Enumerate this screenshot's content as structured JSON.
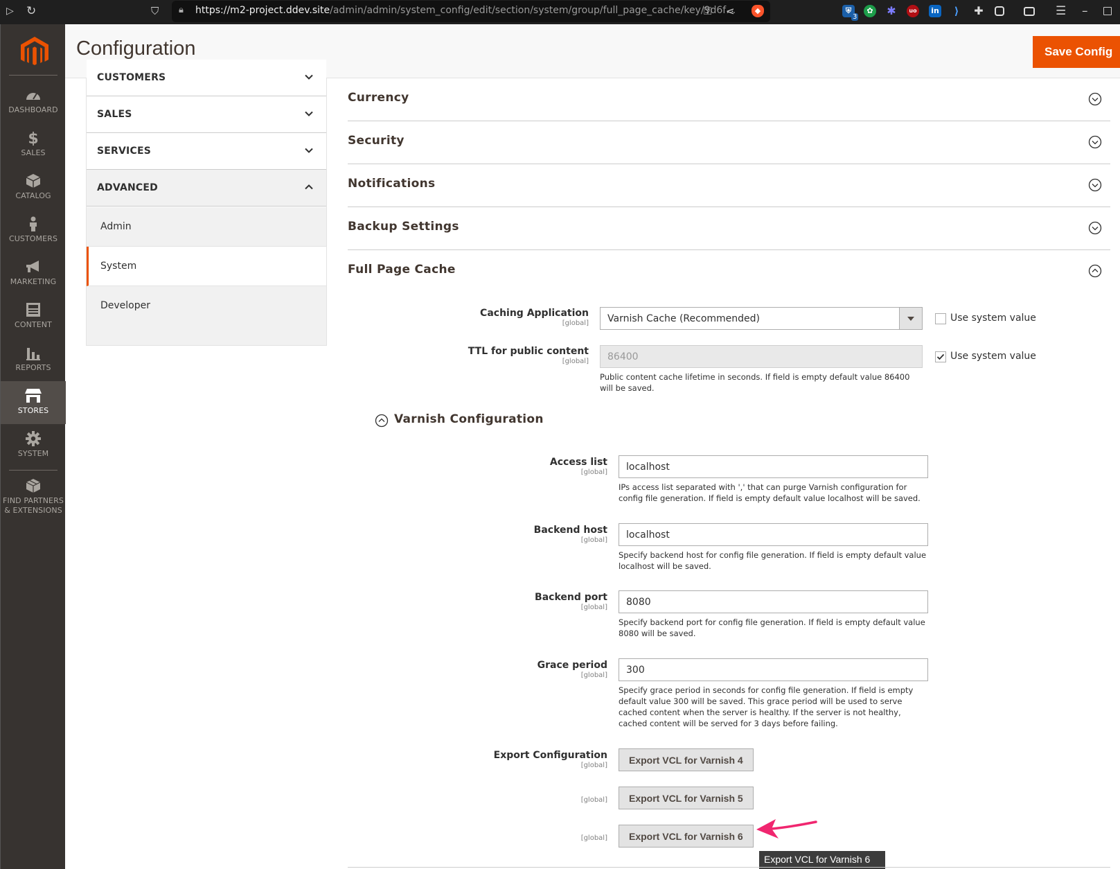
{
  "browser": {
    "url_host": "https://m2-project.ddev.site",
    "url_path": "/admin/admin/system_config/edit/section/system/group/full_page_cache/key/9d6f…",
    "ext_badge": "3"
  },
  "admin_nav": {
    "items": [
      {
        "label": "DASHBOARD",
        "icon": "dashboard-icon"
      },
      {
        "label": "SALES",
        "icon": "dollar-icon"
      },
      {
        "label": "CATALOG",
        "icon": "box-icon"
      },
      {
        "label": "CUSTOMERS",
        "icon": "person-icon"
      },
      {
        "label": "MARKETING",
        "icon": "megaphone-icon"
      },
      {
        "label": "CONTENT",
        "icon": "content-icon"
      },
      {
        "label": "REPORTS",
        "icon": "bar-chart-icon"
      },
      {
        "label": "STORES",
        "icon": "store-icon",
        "active": true
      },
      {
        "label": "SYSTEM",
        "icon": "gear-icon"
      },
      {
        "label_line1": "FIND PARTNERS",
        "label_line2": "& EXTENSIONS",
        "icon": "cubes-icon"
      }
    ]
  },
  "header": {
    "title": "Configuration",
    "save_label": "Save Config"
  },
  "config_tabs": {
    "groups": [
      {
        "label": "CUSTOMERS",
        "expanded": false
      },
      {
        "label": "SALES",
        "expanded": false
      },
      {
        "label": "SERVICES",
        "expanded": false
      },
      {
        "label": "ADVANCED",
        "expanded": true
      }
    ],
    "advanced_items": [
      "Admin",
      "System",
      "Developer"
    ],
    "active_item": "System"
  },
  "sections": {
    "currency": "Currency",
    "security": "Security",
    "notifications": "Notifications",
    "backup": "Backup Settings",
    "fpc": "Full Page Cache"
  },
  "fpc": {
    "caching_app": {
      "label": "Caching Application",
      "scope": "[global]",
      "value": "Varnish Cache (Recommended)",
      "use_system_label": "Use system value",
      "use_system_checked": false
    },
    "ttl": {
      "label": "TTL for public content",
      "scope": "[global]",
      "value": "86400",
      "note": "Public content cache lifetime in seconds. If field is empty default value 86400 will be saved.",
      "use_system_label": "Use system value",
      "use_system_checked": true
    },
    "varnish": {
      "title": "Varnish Configuration",
      "access_list": {
        "label": "Access list",
        "scope": "[global]",
        "value": "localhost",
        "note": "IPs access list separated with ',' that can purge Varnish configuration for config file generation. If field is empty default value localhost will be saved."
      },
      "backend_host": {
        "label": "Backend host",
        "scope": "[global]",
        "value": "localhost",
        "note": "Specify backend host for config file generation. If field is empty default value localhost will be saved."
      },
      "backend_port": {
        "label": "Backend port",
        "scope": "[global]",
        "value": "8080",
        "note": "Specify backend port for config file generation. If field is empty default value 8080 will be saved."
      },
      "grace_period": {
        "label": "Grace period",
        "scope": "[global]",
        "value": "300",
        "note": "Specify grace period in seconds for config file generation. If field is empty default value 300 will be saved. This grace period will be used to serve cached content when the server is healthy. If the server is not healthy, cached content will be served for 3 days before failing."
      },
      "export": {
        "label": "Export Configuration",
        "scope": "[global]",
        "btn4": "Export VCL for Varnish 4",
        "btn5": "Export VCL for Varnish 5",
        "btn6": "Export VCL for Varnish 6",
        "scope5": "[global]",
        "scope6": "[global]"
      }
    }
  },
  "tooltip": "Export VCL for Varnish 6",
  "colors": {
    "accent": "#eb5202",
    "nav_bg": "#373330",
    "arrow": "#f0266f"
  }
}
